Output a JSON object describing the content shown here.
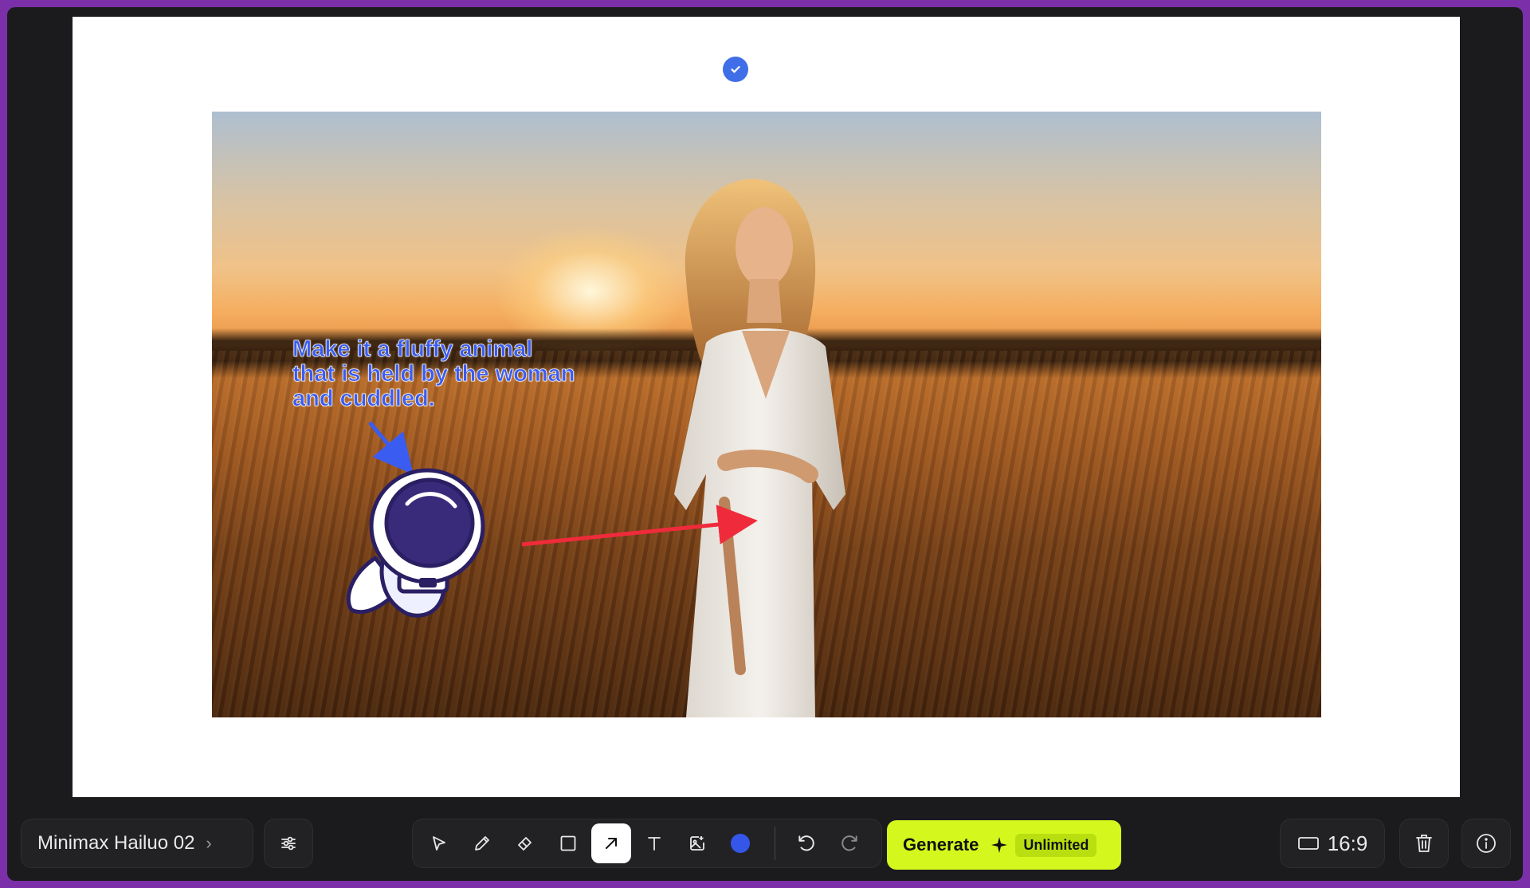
{
  "canvas": {
    "annotation_text": "Make it a fluffy animal that is held by the woman and cuddled.",
    "annotation_color": "#3b5cf0",
    "arrow_color": "#ef2b3b",
    "selected_check_icon": "check-circle-icon",
    "sticker": "astronaut-sticker"
  },
  "toolbar": {
    "model_name": "Minimax Hailuo 02",
    "model_chevron": "chevron-right-icon",
    "settings_icon": "sliders-icon",
    "tools": [
      {
        "name": "select",
        "icon": "cursor-icon",
        "active": false
      },
      {
        "name": "pencil",
        "icon": "pencil-icon",
        "active": false
      },
      {
        "name": "eraser",
        "icon": "eraser-icon",
        "active": false
      },
      {
        "name": "rectangle",
        "icon": "square-icon",
        "active": false
      },
      {
        "name": "arrow",
        "icon": "arrow-up-right-icon",
        "active": true
      },
      {
        "name": "text",
        "icon": "text-icon",
        "active": false
      },
      {
        "name": "image",
        "icon": "image-plus-icon",
        "active": false
      }
    ],
    "current_color": "#3457ea",
    "undo_icon": "undo-icon",
    "redo_icon": "redo-icon",
    "generate_label": "Generate",
    "generate_badge": "Unlimited",
    "generate_color": "#d4f81d",
    "aspect_ratio": "16:9",
    "delete_icon": "trash-icon",
    "info_icon": "info-icon"
  }
}
